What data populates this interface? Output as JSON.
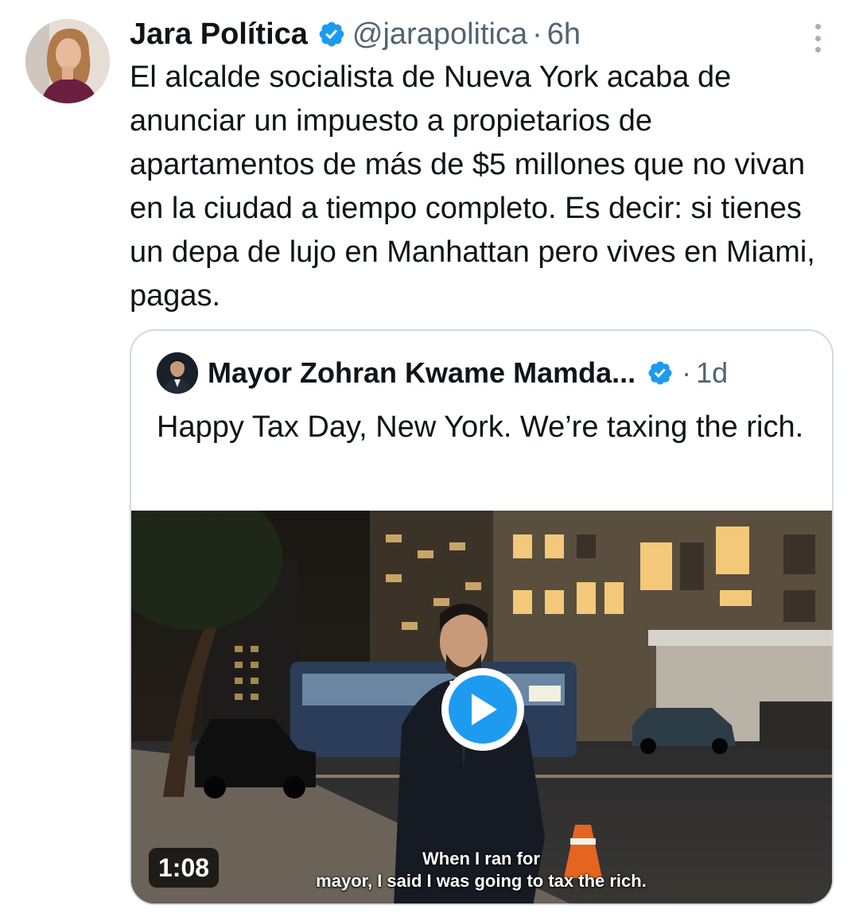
{
  "tweet": {
    "author_name": "Jara Política",
    "author_handle": "@jarapolitica",
    "separator": "·",
    "time": "6h",
    "verified_icon": "verified-badge-icon",
    "more_icon": "more-options-icon",
    "text": "El alcalde socialista de Nueva York acaba de anunciar un impuesto a propietarios de apartamentos de más de $5 millones que no vivan en la ciudad a tiempo completo. Es decir: si tienes un depa de lujo en Manhattan pero vives en Miami, pagas."
  },
  "quote": {
    "author_name": "Mayor Zohran Kwame Mamda...",
    "separator": "·",
    "time": "1d",
    "text": "Happy Tax Day, New York. We’re taxing the rich.",
    "video": {
      "duration": "1:08",
      "caption_line1": "When I ran for",
      "caption_line2": "mayor, I said I was going to tax the rich.",
      "play_icon": "play-icon"
    }
  },
  "colors": {
    "verified": "#1d9bf0",
    "secondary_text": "#536471",
    "border": "#cfd9de",
    "play": "#1d9bf0"
  }
}
